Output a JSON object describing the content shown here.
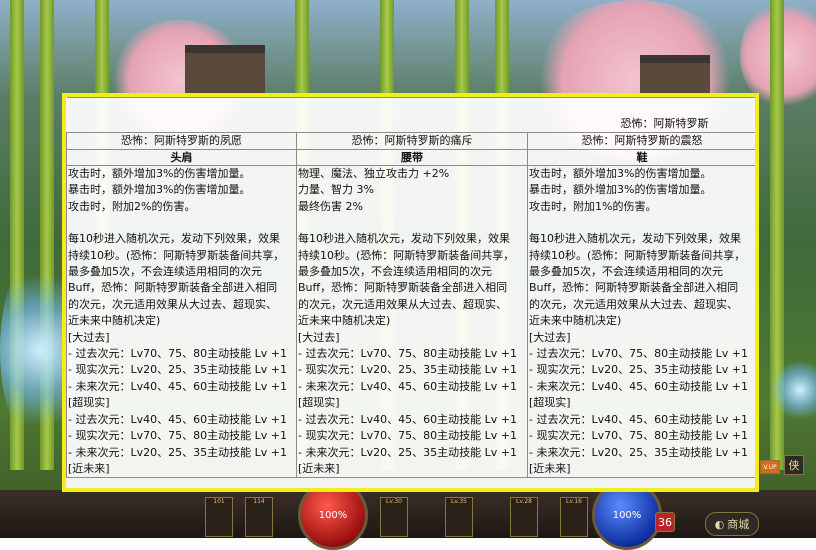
{
  "hud": {
    "hp_value": "100%",
    "mp_value": "100%",
    "shop_label": "商城",
    "xia_label": "侠",
    "up_label": "V.UP",
    "counter_value": "36",
    "slot_counts": [
      "101",
      "114"
    ],
    "skill_levels": [
      "Lv.30",
      "Lv.35",
      "Lv.28",
      "Lv.16"
    ]
  },
  "panel": {
    "title": "恐怖：阿斯特罗斯",
    "columns": [
      {
        "header": "恐怖：阿斯特罗斯的夙愿",
        "slot": "头肩",
        "stats": [
          "攻击时，额外增加3%的伤害增加量。",
          "暴击时，额外增加3%的伤害增加量。",
          "攻击时，附加2%的伤害。"
        ],
        "description": [
          "每10秒进入随机次元，发动下列效果，效果",
          "持续10秒。(恐怖：阿斯特罗斯装备间共享，",
          "最多叠加5次，不会连续适用相同的次元",
          "Buff，恐怖：阿斯特罗斯装备全部进入相同",
          "的次元，次元适用效果从大过去、超现实、",
          "近未来中随机决定)"
        ],
        "sections": [
          {
            "name": "[大过去]",
            "lines": [
              "- 过去次元：Lv70、75、80主动技能 Lv +1",
              "- 现实次元：Lv20、25、35主动技能 Lv +1",
              "- 未来次元：Lv40、45、60主动技能 Lv +1"
            ]
          },
          {
            "name": "[超现实]",
            "lines": [
              "- 过去次元：Lv40、45、60主动技能 Lv +1",
              "- 现实次元：Lv70、75、80主动技能 Lv +1",
              "- 未来次元：Lv20、25、35主动技能 Lv +1"
            ]
          },
          {
            "name": "[近未来]",
            "lines": []
          }
        ]
      },
      {
        "header": "恐怖：阿斯特罗斯的痛斥",
        "slot": "腰带",
        "stats": [
          "物理、魔法、独立攻击力 +2%",
          "力量、智力 3%",
          "最终伤害 2%"
        ],
        "description": [
          "每10秒进入随机次元，发动下列效果，效果",
          "持续10秒。(恐怖：阿斯特罗斯装备间共享，",
          "最多叠加5次，不会连续适用相同的次元",
          "Buff，恐怖：阿斯特罗斯装备全部进入相同",
          "的次元，次元适用效果从大过去、超现实、",
          "近未来中随机决定)"
        ],
        "sections": [
          {
            "name": "[大过去]",
            "lines": [
              "- 过去次元：Lv70、75、80主动技能 Lv +1",
              "- 现实次元：Lv20、25、35主动技能 Lv +1",
              "- 未来次元：Lv40、45、60主动技能 Lv +1"
            ]
          },
          {
            "name": "[超现实]",
            "lines": [
              "- 过去次元：Lv40、45、60主动技能 Lv +1",
              "- 现实次元：Lv70、75、80主动技能 Lv +1",
              "- 未来次元：Lv20、25、35主动技能 Lv +1"
            ]
          },
          {
            "name": "[近未来]",
            "lines": []
          }
        ]
      },
      {
        "header": "恐怖：阿斯特罗斯的震怒",
        "slot": "鞋",
        "stats": [
          "攻击时，额外增加3%的伤害增加量。",
          "暴击时，额外增加3%的伤害增加量。",
          "攻击时，附加1%的伤害。"
        ],
        "description": [
          "每10秒进入随机次元，发动下列效果，效果",
          "持续10秒。(恐怖：阿斯特罗斯装备间共享，",
          "最多叠加5次，不会连续适用相同的次元",
          "Buff，恐怖：阿斯特罗斯装备全部进入相同",
          "的次元，次元适用效果从大过去、超现实、",
          "近未来中随机决定)"
        ],
        "sections": [
          {
            "name": "[大过去]",
            "lines": [
              "- 过去次元：Lv70、75、80主动技能 Lv +1",
              "- 现实次元：Lv20、25、35主动技能 Lv +1",
              "- 未来次元：Lv40、45、60主动技能 Lv +1"
            ]
          },
          {
            "name": "[超现实]",
            "lines": [
              "- 过去次元：Lv40、45、60主动技能 Lv +1",
              "- 现实次元：Lv70、75、80主动技能 Lv +1",
              "- 未来次元：Lv20、25、35主动技能 Lv +1"
            ]
          },
          {
            "name": "[近未来]",
            "lines": []
          }
        ]
      }
    ]
  }
}
